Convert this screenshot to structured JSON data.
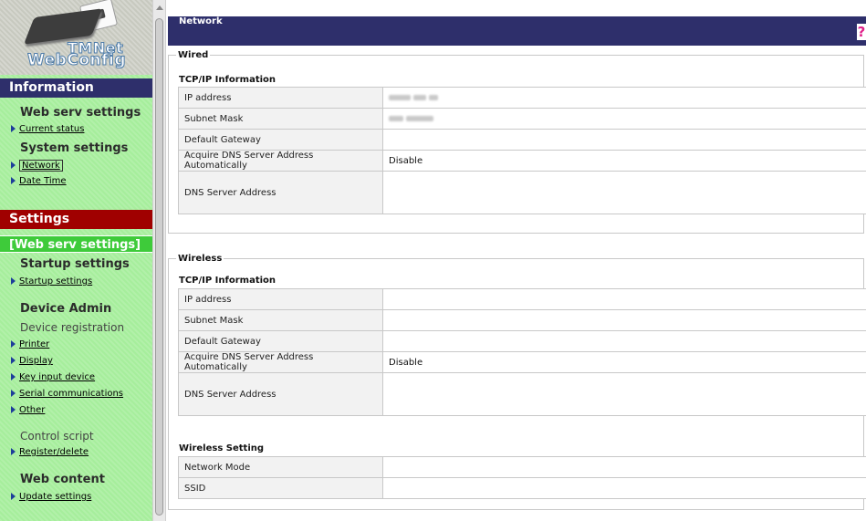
{
  "logo": {
    "line1": "TMNet",
    "line2": "WebConfig"
  },
  "sidebar": {
    "information_header": "Information",
    "info_groups": [
      {
        "title": "Web serv settings",
        "links": [
          "Current status"
        ]
      },
      {
        "title": "System settings",
        "links": [
          "Network",
          "Date Time"
        ]
      }
    ],
    "settings_header": "Settings",
    "active_section": "[Web serv settings]",
    "startup": {
      "title": "Startup settings",
      "links": [
        "Startup settings"
      ]
    },
    "device_admin": {
      "title": "Device Admin",
      "registration_label": "Device registration",
      "links": [
        "Printer",
        "Display",
        "Key input device",
        "Serial communications",
        "Other"
      ]
    },
    "control_script": {
      "label": "Control script",
      "links": [
        "Register/delete"
      ]
    },
    "web_content": {
      "title": "Web content",
      "links": [
        "Update settings"
      ]
    }
  },
  "main": {
    "title": "Network",
    "help_icon": "?",
    "wired": {
      "legend": "Wired",
      "section_title": "TCP/IP Information",
      "rows": [
        {
          "label": "IP address",
          "value": ""
        },
        {
          "label": "Subnet Mask",
          "value": ""
        },
        {
          "label": "Default Gateway",
          "value": ""
        },
        {
          "label": "Acquire DNS Server Address Automatically",
          "value": "Disable"
        },
        {
          "label": "DNS Server Address",
          "value": ""
        }
      ]
    },
    "wireless": {
      "legend": "Wireless",
      "section_title": "TCP/IP Information",
      "rows": [
        {
          "label": "IP address",
          "value": ""
        },
        {
          "label": "Subnet Mask",
          "value": ""
        },
        {
          "label": "Default Gateway",
          "value": ""
        },
        {
          "label": "Acquire DNS Server Address Automatically",
          "value": "Disable"
        },
        {
          "label": "DNS Server Address",
          "value": ""
        }
      ],
      "setting_title": "Wireless Setting",
      "setting_rows": [
        {
          "label": "Network Mode",
          "value": ""
        },
        {
          "label": "SSID",
          "value": ""
        }
      ]
    }
  },
  "colors": {
    "sidebar_bg": "#a6ee9c",
    "info_header": "#2e2f6b",
    "settings_header": "#a00000",
    "active_group": "#3ecb3a"
  }
}
